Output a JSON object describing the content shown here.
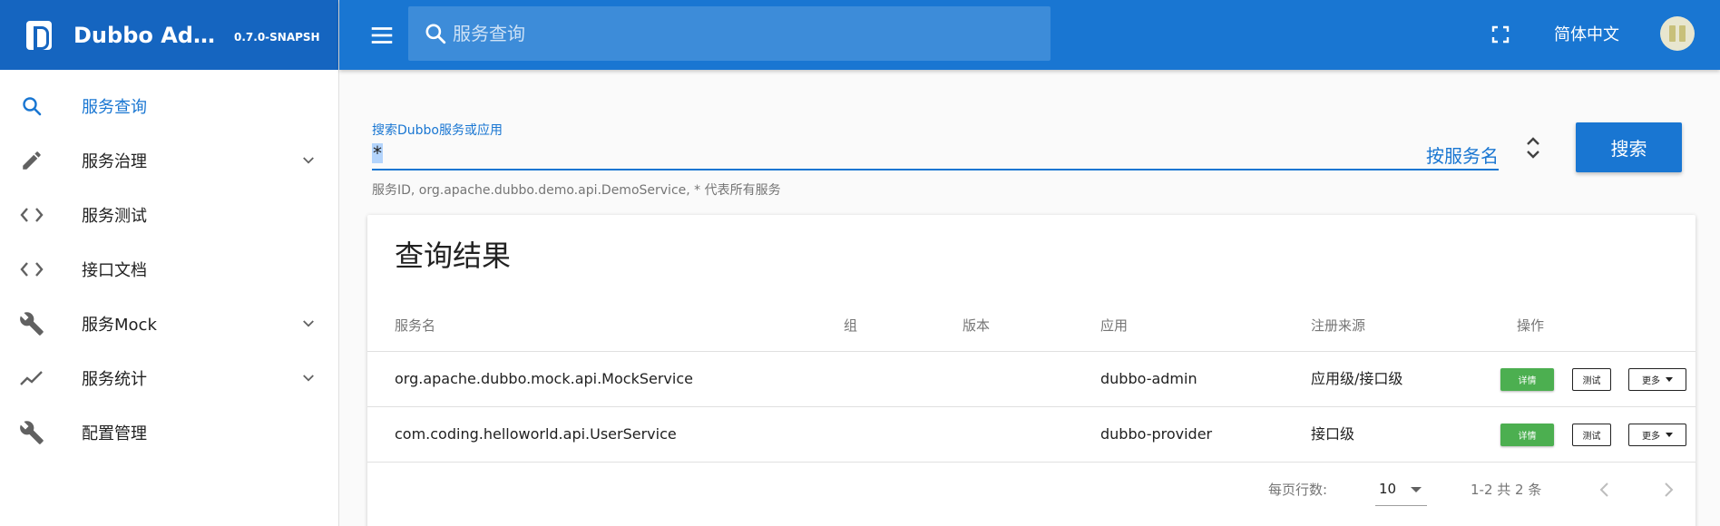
{
  "brand": {
    "title": "Dubbo Admin...",
    "version": "0.7.0-SNAPSH"
  },
  "sidebar": {
    "items": [
      {
        "label": "服务查询",
        "icon": "search-icon",
        "active": true,
        "expandable": false
      },
      {
        "label": "服务治理",
        "icon": "pencil-icon",
        "active": false,
        "expandable": true
      },
      {
        "label": "服务测试",
        "icon": "code-icon",
        "active": false,
        "expandable": false
      },
      {
        "label": "接口文档",
        "icon": "code-icon",
        "active": false,
        "expandable": false
      },
      {
        "label": "服务Mock",
        "icon": "wrench-icon",
        "active": false,
        "expandable": true
      },
      {
        "label": "服务统计",
        "icon": "trending-icon",
        "active": false,
        "expandable": true
      },
      {
        "label": "配置管理",
        "icon": "wrench-icon",
        "active": false,
        "expandable": false
      }
    ]
  },
  "header": {
    "search_placeholder": "服务查询",
    "language": "简体中文"
  },
  "search": {
    "label": "搜索Dubbo服务或应用",
    "value": "*",
    "suffix": "按服务名",
    "button": "搜索",
    "hint": "服务ID, org.apache.dubbo.demo.api.DemoService, * 代表所有服务"
  },
  "results": {
    "title": "查询结果",
    "columns": [
      "服务名",
      "组",
      "版本",
      "应用",
      "注册来源",
      "操作"
    ],
    "rows": [
      {
        "service": "org.apache.dubbo.mock.api.MockService",
        "group": "",
        "version": "",
        "app": "dubbo-admin",
        "source": "应用级/接口级"
      },
      {
        "service": "com.coding.helloworld.api.UserService",
        "group": "",
        "version": "",
        "app": "dubbo-provider",
        "source": "接口级"
      }
    ],
    "actions": {
      "detail": "详情",
      "test": "测试",
      "more": "更多"
    },
    "footer": {
      "rows_per_page_label": "每页行数:",
      "rows_per_page": "10",
      "page_info": "1-2 共 2 条"
    }
  },
  "colors": {
    "primary": "#1976d2",
    "brand": "#1565c0",
    "success": "#4caf50"
  }
}
